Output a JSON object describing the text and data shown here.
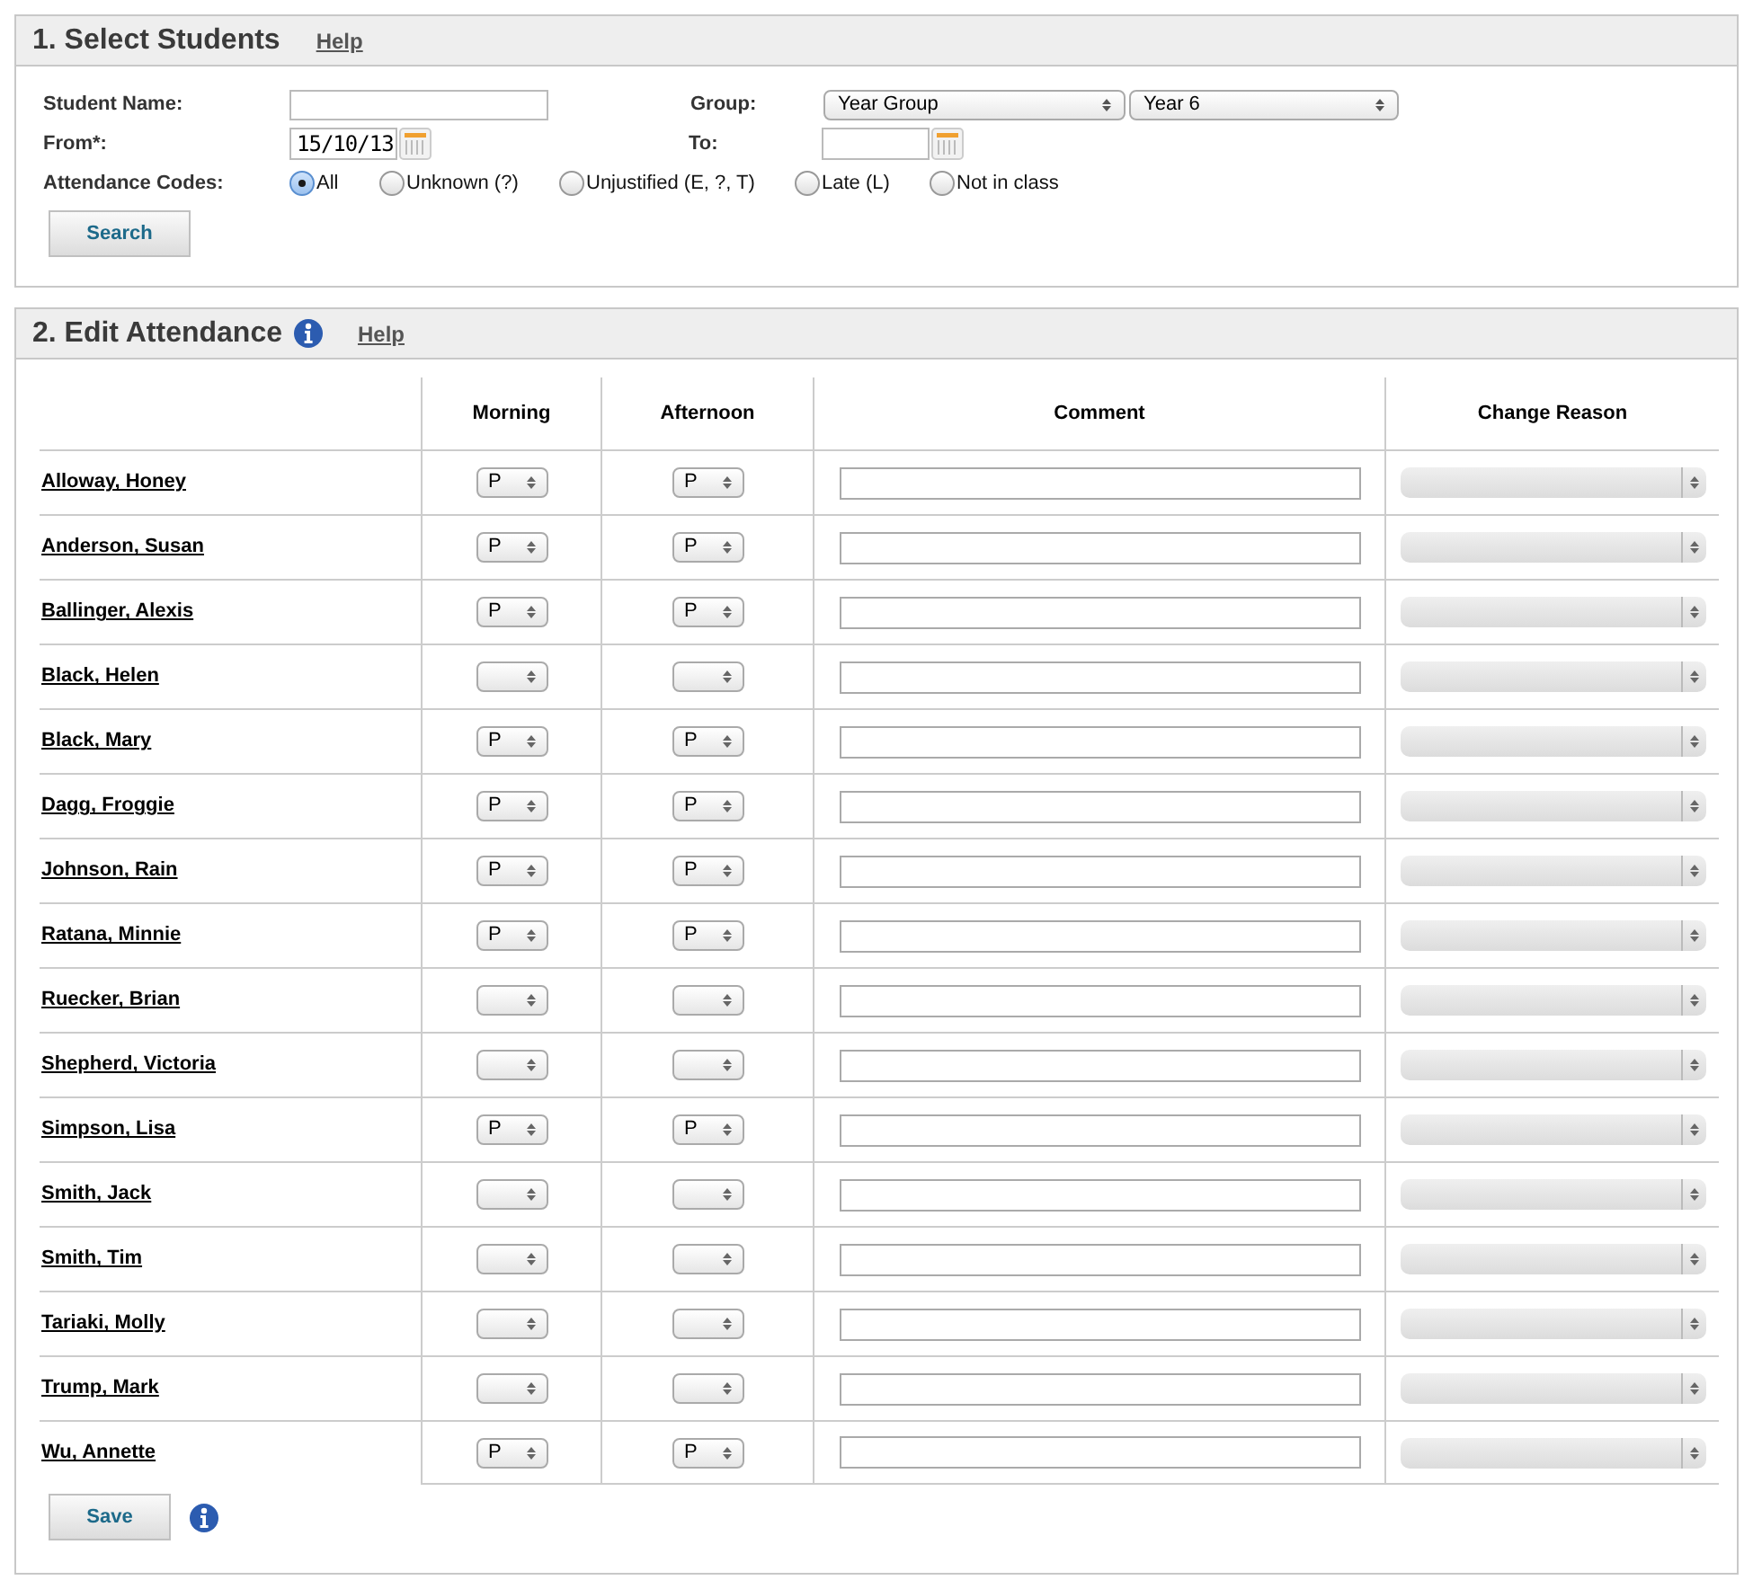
{
  "select_students": {
    "title": "1. Select Students",
    "help": "Help",
    "student_name": {
      "label": "Student Name:"
    },
    "group": {
      "label": "Group:",
      "type_value": "Year Group",
      "value": "Year 6"
    },
    "from": {
      "label": "From*:",
      "value": "15/10/13"
    },
    "to": {
      "label": "To:"
    },
    "attendance_codes": {
      "label": "Attendance Codes:",
      "options": [
        {
          "label": "All",
          "selected": true
        },
        {
          "label": "Unknown (?)",
          "selected": false
        },
        {
          "label": "Unjustified (E, ?, T)",
          "selected": false
        },
        {
          "label": "Late (L)",
          "selected": false
        },
        {
          "label": "Not in class",
          "selected": false
        }
      ]
    },
    "search_button": "Search"
  },
  "edit_attendance": {
    "title": "2. Edit Attendance",
    "help": "Help",
    "columns": [
      "Morning",
      "Afternoon",
      "Comment",
      "Change Reason"
    ],
    "rows": [
      {
        "name": "Alloway, Honey",
        "morning": "P",
        "afternoon": "P"
      },
      {
        "name": "Anderson, Susan",
        "morning": "P",
        "afternoon": "P"
      },
      {
        "name": "Ballinger, Alexis",
        "morning": "P",
        "afternoon": "P"
      },
      {
        "name": "Black, Helen"
      },
      {
        "name": "Black, Mary",
        "morning": "P",
        "afternoon": "P"
      },
      {
        "name": "Dagg, Froggie",
        "morning": "P",
        "afternoon": "P"
      },
      {
        "name": "Johnson, Rain",
        "morning": "P",
        "afternoon": "P"
      },
      {
        "name": "Ratana, Minnie",
        "morning": "P",
        "afternoon": "P"
      },
      {
        "name": "Ruecker, Brian"
      },
      {
        "name": "Shepherd, Victoria"
      },
      {
        "name": "Simpson, Lisa",
        "morning": "P",
        "afternoon": "P"
      },
      {
        "name": "Smith, Jack"
      },
      {
        "name": "Smith, Tim"
      },
      {
        "name": "Tariaki, Molly"
      },
      {
        "name": "Trump, Mark"
      },
      {
        "name": "Wu, Annette",
        "morning": "P",
        "afternoon": "P"
      }
    ],
    "change_reason_disabled": true,
    "save_button": "Save"
  }
}
